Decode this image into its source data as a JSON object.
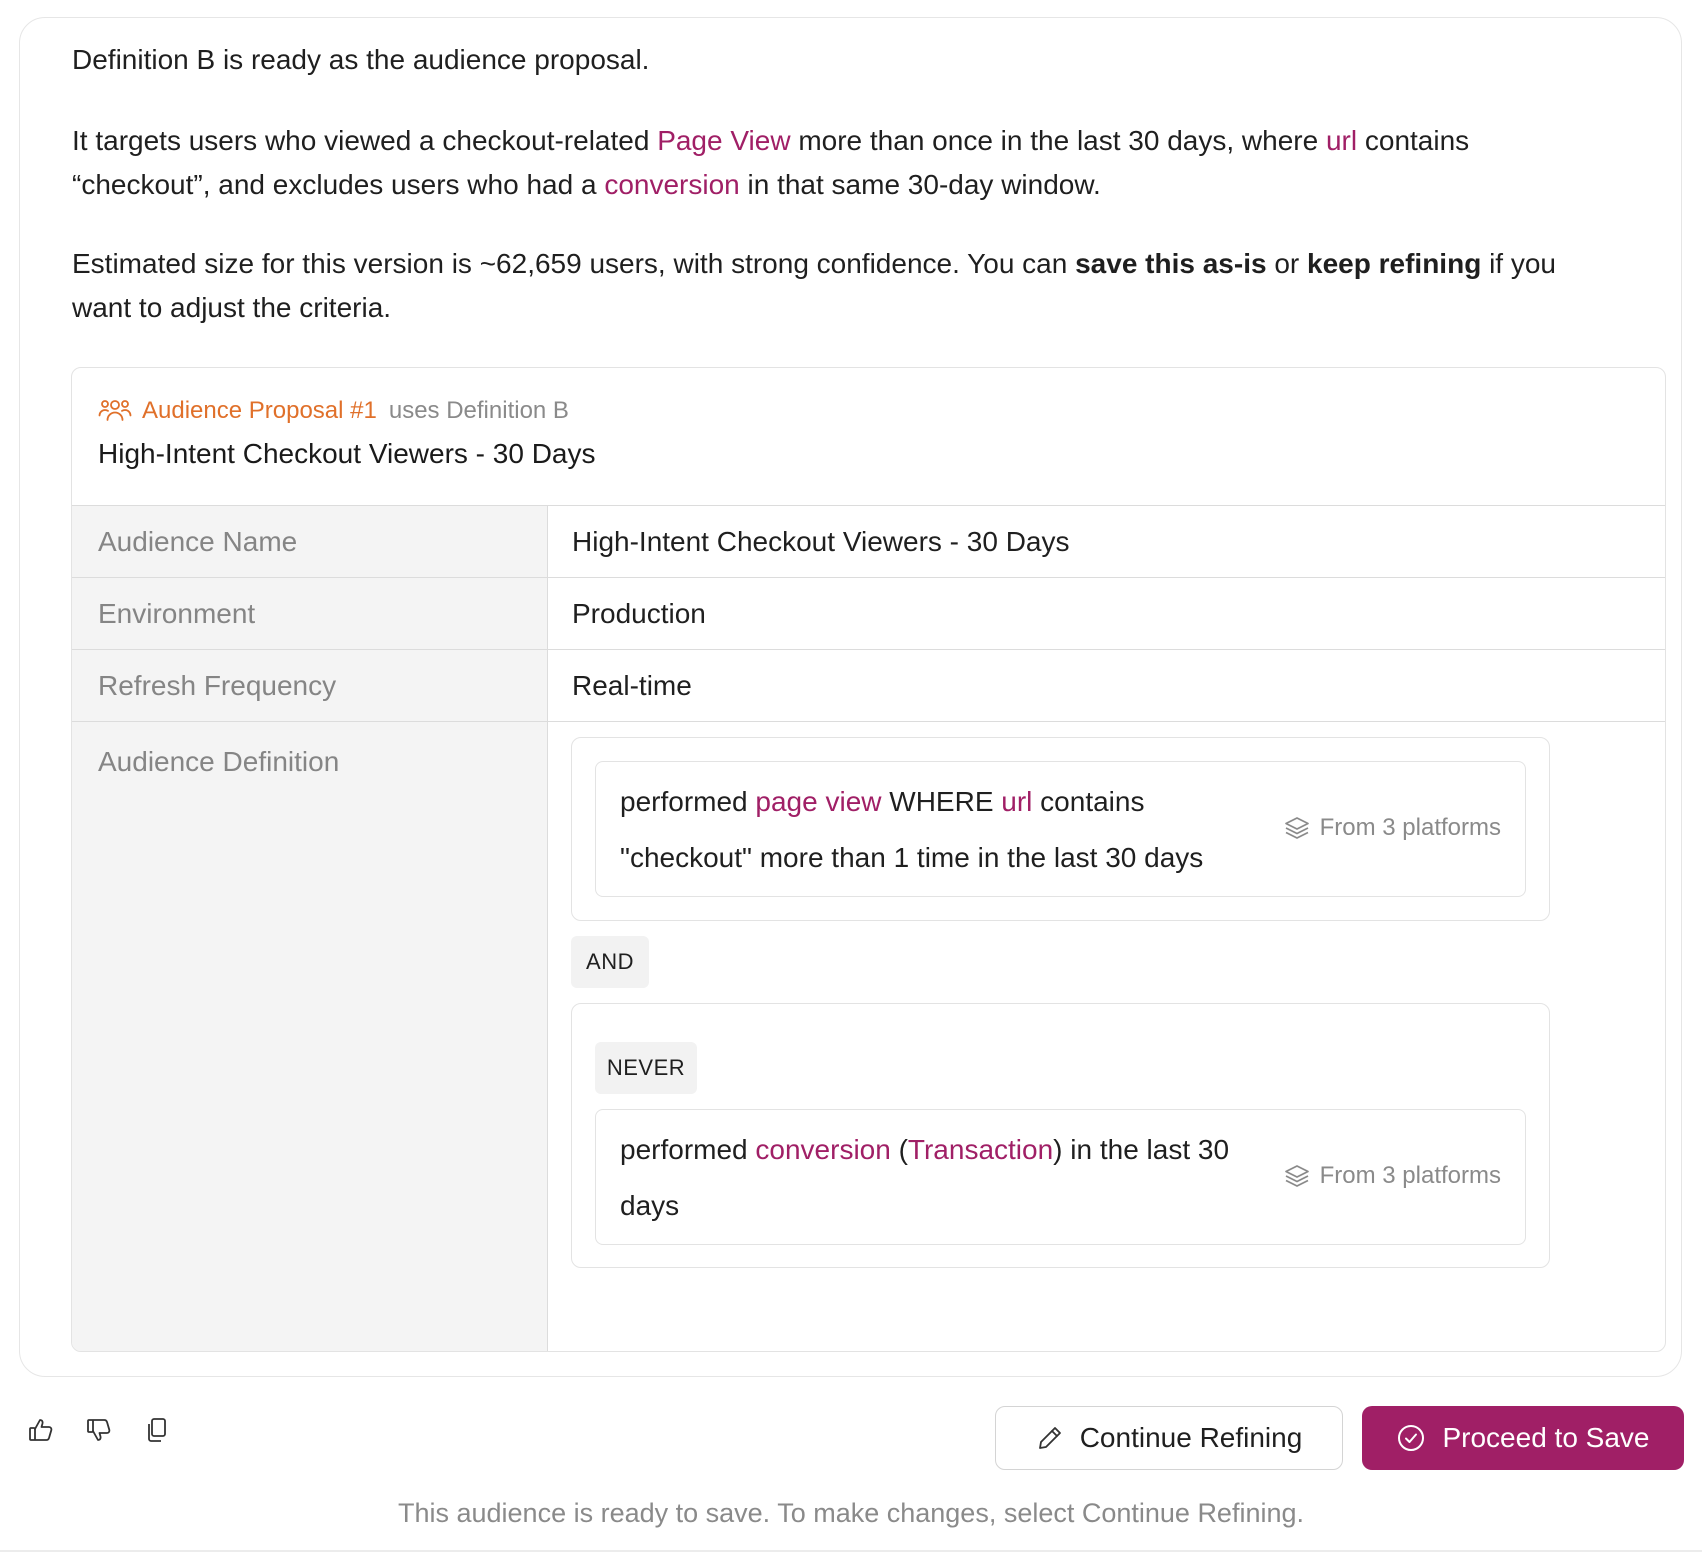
{
  "message": {
    "p1": "Definition B is ready as the audience proposal.",
    "p2": {
      "t1": "It targets users who viewed a checkout-related ",
      "h1": "Page View",
      "t2": " more than once in the last 30 days, where ",
      "h2": "url",
      "t3": " contains",
      "t4": "“checkout”, and excludes users who had a ",
      "h3": "conversion",
      "t5": " in that same 30-day window."
    },
    "p3": {
      "t1": "Estimated size for this version is ~62,659 users, with strong confidence. You can ",
      "b1": "save this as-is",
      "t2": " or ",
      "b2": "keep refining",
      "t3": " if you",
      "t4": "want to adjust the criteria."
    }
  },
  "proposal": {
    "tag": "Audience Proposal #1",
    "uses": "uses Definition B",
    "title": "High-Intent Checkout Viewers - 30 Days",
    "rows": [
      {
        "label": "Audience Name",
        "value": "High-Intent Checkout Viewers - 30 Days"
      },
      {
        "label": "Environment",
        "value": "Production"
      },
      {
        "label": "Refresh Frequency",
        "value": "Real-time"
      }
    ],
    "definition": {
      "label": "Audience Definition",
      "cond1": {
        "t1": "performed ",
        "h1": "page view",
        "t2": " WHERE ",
        "h2": "url",
        "t3": " contains",
        "t4": "\"checkout\" more than 1 time in the last 30 days",
        "platforms": "From 3 platforms"
      },
      "and_label": "AND",
      "never_label": "NEVER",
      "cond2": {
        "t1": "performed ",
        "h1": "conversion",
        "t2": " (",
        "h2": "Transaction",
        "t3": ") in the last 30",
        "t4": "days",
        "platforms": "From 3 platforms"
      }
    }
  },
  "actions": {
    "refine_label": "Continue Refining",
    "save_label": "Proceed to Save",
    "footnote": "This audience is ready to save. To make changes, select Continue Refining."
  },
  "colors": {
    "accent": "#a01f66",
    "tag_orange": "#e0702a"
  },
  "icons": [
    "people-icon",
    "layers-icon",
    "thumbs-up-icon",
    "thumbs-down-icon",
    "copy-icon",
    "pencil-icon",
    "check-circle-icon"
  ]
}
